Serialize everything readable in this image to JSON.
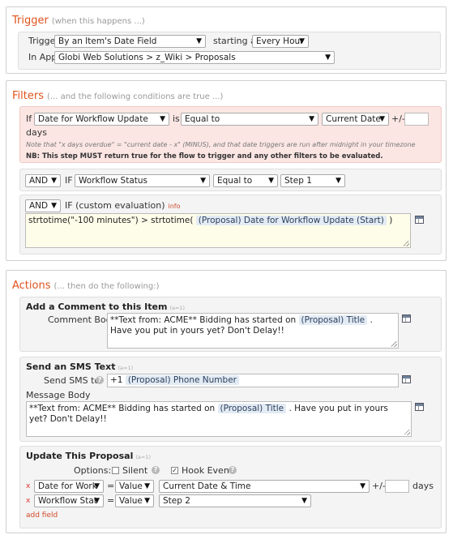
{
  "trigger": {
    "title": "Trigger",
    "subtitle": "(when this happens ...)",
    "trigger_label": "Trigger:",
    "trigger_value": "By an Item's Date Field",
    "starting_at_label": "starting at",
    "starting_at_value": "Every Hour",
    "app_label": "In App:",
    "app_value": "Globi Web Solutions > z_Wiki > Proposals"
  },
  "filters": {
    "title": "Filters",
    "subtitle": "(... and the following conditions are true ...)",
    "date_filter": {
      "if_label": "If",
      "field": "Date for Workflow Update",
      "is_label": "is",
      "operator": "Equal to",
      "value": "Current Date",
      "plusminus": "+/-",
      "days_label": "days",
      "note": "Note that \"x days overdue\" = \"current date - x\" (MINUS), and that date triggers are run after midnight in your timezone",
      "nb": "NB: This step MUST return true for the flow to trigger and any other filters to be evaluated."
    },
    "status_filter": {
      "conj": "AND",
      "if_label": "IF",
      "field": "Workflow Status",
      "operator": "Equal to",
      "value": "Step 1"
    },
    "custom_filter": {
      "conj": "AND",
      "label": "IF (custom evaluation)",
      "info": "info",
      "code_prefix": "strtotime(\"-100 minutes\") > strtotime(",
      "token": "(Proposal) Date for Workflow Update (Start)",
      "code_suffix": ")"
    }
  },
  "actions": {
    "title": "Actions",
    "subtitle": "(... then do the following:)",
    "comment": {
      "title": "Add a Comment to this Item",
      "tag": "(a=1)",
      "body_label": "Comment Body",
      "body_prefix": "**Text from: ACME** Bidding has started on",
      "token": "(Proposal) Title",
      "body_suffix": ". Have you put in yours yet? Don't Delay!!"
    },
    "sms": {
      "title": "Send an SMS Text",
      "tag": "(a=1)",
      "send_to_label": "Send SMS to",
      "send_to_prefix": "+1",
      "send_to_token": "(Proposal) Phone Number",
      "message_label": "Message Body",
      "message_prefix": "**Text from: ACME** Bidding has started on",
      "message_token": "(Proposal) Title",
      "message_suffix": ". Have you put in yours yet? Don't Delay!!"
    },
    "update": {
      "title": "Update This Proposal",
      "tag": "(a=1)",
      "options_label": "Options:",
      "silent_label": "Silent",
      "hook_label": "Hook Event",
      "row1": {
        "field": "Date for Work",
        "eq": "=",
        "type": "Value",
        "value": "Current Date & Time",
        "plusminus": "+/-",
        "days": "days"
      },
      "row2": {
        "field": "Workflow Stat",
        "eq": "=",
        "type": "Value",
        "value": "Step 2"
      },
      "add_field": "add field"
    }
  },
  "colors": {
    "accent": "#e0521d",
    "token_bg": "#e3ebf4",
    "filter_red_bg": "#fbe6e3",
    "code_bg": "#fdfde9"
  }
}
